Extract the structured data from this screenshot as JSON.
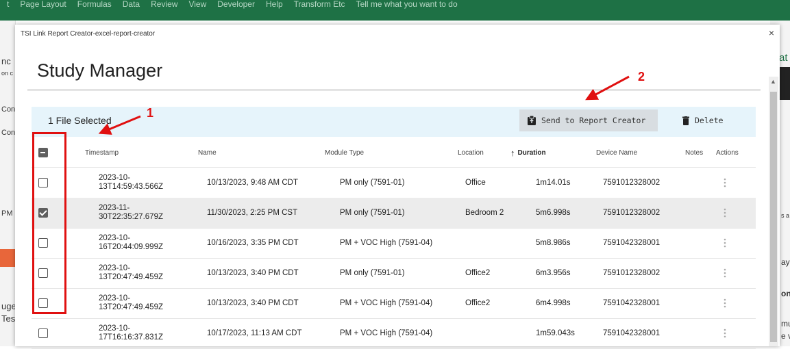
{
  "excel": {
    "menu": [
      "t",
      "Page Layout",
      "Formulas",
      "Data",
      "Review",
      "View",
      "Developer",
      "Help",
      "Transform Etc",
      "Tell me what you want to do"
    ],
    "left_fragments": [
      "nc",
      "on c",
      "Con",
      "Con",
      "PM",
      "uge",
      "Tes"
    ],
    "right_fragments": [
      "^at",
      "s a",
      "ayo",
      "on",
      "mu",
      "e v"
    ]
  },
  "dialog": {
    "title": "TSI Link Report Creator-excel-report-creator",
    "close_symbol": "×",
    "heading": "Study Manager"
  },
  "toolbar": {
    "selected_label": "1 File Selected",
    "send_label": "Send to Report Creator",
    "delete_label": "Delete"
  },
  "table": {
    "headers": {
      "timestamp": "Timestamp",
      "name": "Name",
      "module_type": "Module Type",
      "location": "Location",
      "duration": "Duration",
      "device_name": "Device Name",
      "notes": "Notes",
      "actions": "Actions"
    },
    "sort_indicator": "↑",
    "select_all_state": "indeterminate",
    "rows": [
      {
        "checked": false,
        "timestamp": "2023-10-13T14:59:43.566Z",
        "name": "10/13/2023, 9:48 AM CDT",
        "module_type": "PM only (7591-01)",
        "location": "Office",
        "duration": "1m14.01s",
        "device_name": "7591012328002",
        "notes": ""
      },
      {
        "checked": true,
        "timestamp": "2023-11-30T22:35:27.679Z",
        "name": "11/30/2023, 2:25 PM CST",
        "module_type": "PM only (7591-01)",
        "location": "Bedroom 2",
        "duration": "5m6.998s",
        "device_name": "7591012328002",
        "notes": ""
      },
      {
        "checked": false,
        "timestamp": "2023-10-16T20:44:09.999Z",
        "name": "10/16/2023, 3:35 PM CDT",
        "module_type": "PM + VOC High (7591-04)",
        "location": "",
        "duration": "5m8.986s",
        "device_name": "7591042328001",
        "notes": ""
      },
      {
        "checked": false,
        "timestamp": "2023-10-13T20:47:49.459Z",
        "name": "10/13/2023, 3:40 PM CDT",
        "module_type": "PM only (7591-01)",
        "location": "Office2",
        "duration": "6m3.956s",
        "device_name": "7591012328002",
        "notes": ""
      },
      {
        "checked": false,
        "timestamp": "2023-10-13T20:47:49.459Z",
        "name": "10/13/2023, 3:40 PM CDT",
        "module_type": "PM + VOC High (7591-04)",
        "location": "Office2",
        "duration": "6m4.998s",
        "device_name": "7591042328001",
        "notes": ""
      },
      {
        "checked": false,
        "timestamp": "2023-10-17T16:16:37.831Z",
        "name": "10/17/2023, 11:13 AM CDT",
        "module_type": "PM + VOC High (7591-04)",
        "location": "",
        "duration": "1m59.043s",
        "device_name": "7591042328001",
        "notes": ""
      }
    ]
  },
  "annotations": {
    "label_1": "1",
    "label_2": "2",
    "color": "#e01010"
  },
  "icons": {
    "send": "clipboard-icon",
    "delete": "trash-icon",
    "actions": "kebab-menu-icon",
    "search": "lightbulb-icon"
  }
}
